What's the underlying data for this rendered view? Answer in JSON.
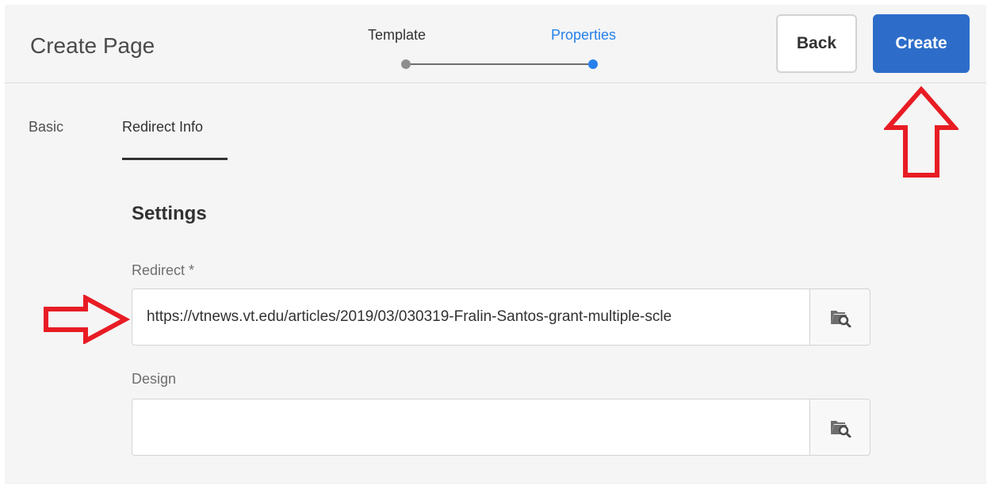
{
  "header": {
    "title": "Create Page",
    "steps": [
      {
        "label": "Template",
        "state": "completed"
      },
      {
        "label": "Properties",
        "state": "active"
      }
    ],
    "back_label": "Back",
    "create_label": "Create"
  },
  "tabs": [
    {
      "label": "Basic",
      "active": false
    },
    {
      "label": "Redirect Info",
      "active": true
    }
  ],
  "form": {
    "section_title": "Settings",
    "redirect": {
      "label": "Redirect *",
      "value": "https://vtnews.vt.edu/articles/2019/03/030319-Fralin-Santos-grant-multiple-scle",
      "picker_icon": "folder-search-icon"
    },
    "design": {
      "label": "Design",
      "value": "",
      "picker_icon": "folder-search-icon"
    }
  },
  "colors": {
    "accent": "#2680eb",
    "create_button": "#2d6dc9",
    "annotation": "#e81c24"
  }
}
